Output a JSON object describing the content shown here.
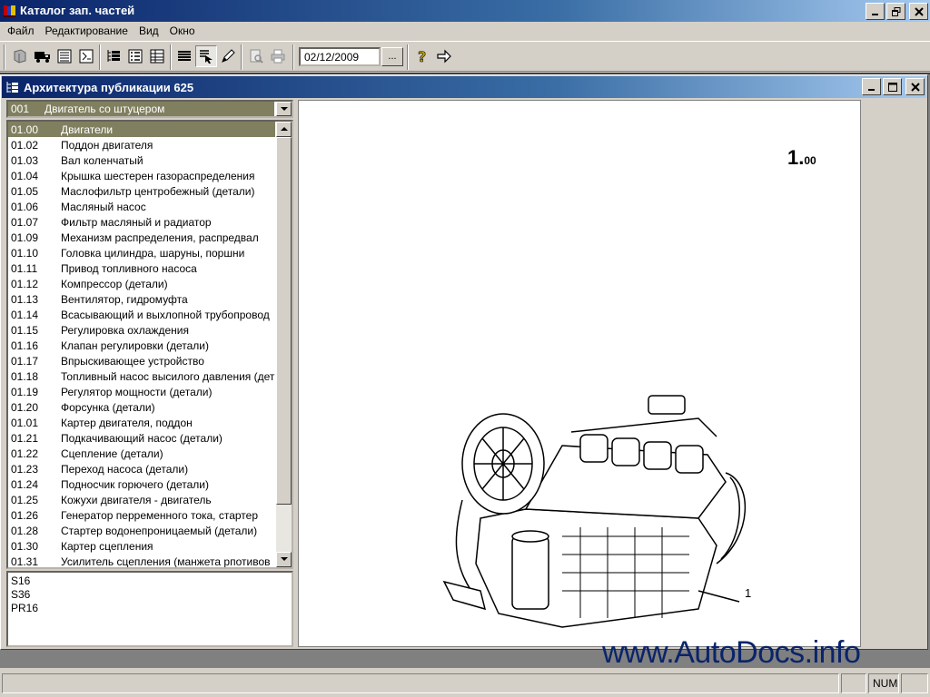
{
  "app": {
    "title": "Каталог зап. частей"
  },
  "menu": {
    "items": [
      {
        "label": "Файл"
      },
      {
        "label": "Редактирование"
      },
      {
        "label": "Вид"
      },
      {
        "label": "Окно"
      }
    ]
  },
  "toolbar": {
    "date_value": "02/12/2009",
    "date_button": "...",
    "icons": [
      "open-book-icon",
      "truck-icon",
      "list-icon",
      "catalog-icon",
      "tree-icon",
      "numbered-list-icon",
      "table-icon",
      "lines-icon",
      "select-cursor-icon",
      "pencil-icon",
      "print-preview-icon",
      "print-icon",
      "help-icon",
      "arrow-right-icon"
    ]
  },
  "child_window": {
    "title": "Архитектура публикации 625"
  },
  "group_combo": {
    "code": "001",
    "label": "Двигатель со штуцером"
  },
  "parts_list": [
    {
      "code": "01.00",
      "name": "Двигатели",
      "selected": true
    },
    {
      "code": "01.02",
      "name": "Поддон двигателя"
    },
    {
      "code": "01.03",
      "name": "Вал коленчатый"
    },
    {
      "code": "01.04",
      "name": "Крышка шестерен газораспределения"
    },
    {
      "code": "01.05",
      "name": "Маслофильтр центробежный (детали)"
    },
    {
      "code": "01.06",
      "name": "Масляный насос"
    },
    {
      "code": "01.07",
      "name": "Фильтр масляный и радиатор"
    },
    {
      "code": "01.09",
      "name": "Механизм распределения, распредвал"
    },
    {
      "code": "01.10",
      "name": "Головка цилиндра, шаруны, поршни"
    },
    {
      "code": "01.11",
      "name": "Привод топливного насоса"
    },
    {
      "code": "01.12",
      "name": "Компрессор  (детали)"
    },
    {
      "code": "01.13",
      "name": "Вентилятор, гидромуфта"
    },
    {
      "code": "01.14",
      "name": "Всасывающий и выхлопной трубопровод"
    },
    {
      "code": "01.15",
      "name": "Регулировка охлаждения"
    },
    {
      "code": "01.16",
      "name": "Клапан регулировки (детали)"
    },
    {
      "code": "01.17",
      "name": "Впрыскивающее устройство"
    },
    {
      "code": "01.18",
      "name": "Топливный насос высилого давления (дет"
    },
    {
      "code": "01.19",
      "name": "Регулятор мощности (детали)"
    },
    {
      "code": "01.20",
      "name": "Форсунка (детали)"
    },
    {
      "code": "01.01",
      "name": "Картер двигателя, поддон"
    },
    {
      "code": "01.21",
      "name": "Подкачивающий насос (детали)"
    },
    {
      "code": "01.22",
      "name": "Сцепление (детали)"
    },
    {
      "code": "01.23",
      "name": "Переход насоса (детали)"
    },
    {
      "code": "01.24",
      "name": "Подносчик горючего (детали)"
    },
    {
      "code": "01.25",
      "name": "Кожухи двигателя - двигатель"
    },
    {
      "code": "01.26",
      "name": "Генератор перременного тока, стартер"
    },
    {
      "code": "01.28",
      "name": "Стартер водонепроницаемый (детали)"
    },
    {
      "code": "01.30",
      "name": "Картер сцепления"
    },
    {
      "code": "01.31",
      "name": "Усилитель сцепления (манжета рпотивов"
    }
  ],
  "model_codes": [
    "S16",
    "S36",
    "PR16"
  ],
  "drawing": {
    "page_main": "1.",
    "page_sub": "00",
    "callout": "1"
  },
  "watermark": "www.AutoDocs.info",
  "status": {
    "num_indicator": "NUM"
  }
}
